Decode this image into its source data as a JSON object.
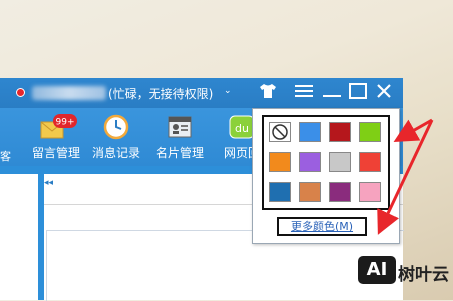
{
  "window": {
    "status_text": "(忙碌，无接待权限)",
    "status_caret": "⌄"
  },
  "titlebar_icons": [
    "tshirt-skin-icon",
    "menu-icon",
    "minimize-icon",
    "maximize-icon",
    "close-icon"
  ],
  "toolbar": {
    "partial_left": "客",
    "items": [
      {
        "label": "留言管理",
        "icon": "envelope-icon",
        "badge": "99+"
      },
      {
        "label": "消息记录",
        "icon": "clock-icon"
      },
      {
        "label": "名片管理",
        "icon": "contact-card-icon"
      },
      {
        "label": "网页回",
        "icon": "web-du-icon"
      }
    ]
  },
  "collapse_glyph": "◂◂",
  "color_popup": {
    "swatches": [
      {
        "name": "none",
        "color": "none"
      },
      {
        "name": "blue",
        "color": "#3b8fe8"
      },
      {
        "name": "dark-red",
        "color": "#b5171c"
      },
      {
        "name": "green",
        "color": "#7fcf15"
      },
      {
        "name": "orange",
        "color": "#f28a1c"
      },
      {
        "name": "purple",
        "color": "#9b5fe0"
      },
      {
        "name": "gray",
        "color": "#c8c8c8"
      },
      {
        "name": "red",
        "color": "#ef4136"
      },
      {
        "name": "steel-blue",
        "color": "#1f6fb0"
      },
      {
        "name": "brown-orange",
        "color": "#d8824a"
      },
      {
        "name": "plum",
        "color": "#8a2c7d"
      },
      {
        "name": "pink",
        "color": "#f6a3bf"
      }
    ],
    "more_colors_label": "更多颜色(M)"
  },
  "annotation_color": "#e8262b",
  "watermark": {
    "logo": "AI",
    "text": "树叶云"
  }
}
